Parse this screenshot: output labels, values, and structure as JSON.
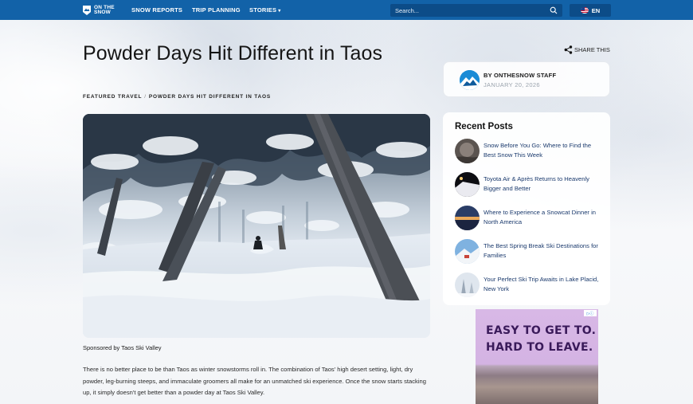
{
  "nav": {
    "logo_text_line1": "ON THE",
    "logo_text_line2": "SNOW",
    "links": [
      "SNOW REPORTS",
      "TRIP PLANNING",
      "STORIES"
    ],
    "search_placeholder": "Search...",
    "language": "EN",
    "brand_color": "#1262a8"
  },
  "article": {
    "title": "Powder Days Hit Different in Taos",
    "share_label": "SHARE THIS",
    "author": "BY ONTHESNOW STAFF",
    "date": "JANUARY 20, 2026",
    "breadcrumb": [
      "FEATURED TRAVEL",
      "POWDER DAYS HIT DIFFERENT IN TAOS"
    ],
    "breadcrumb_sep": "/",
    "caption": "Sponsored by Taos Ski Valley",
    "paragraph": "There is no better place to be than Taos as winter snowstorms roll in. The combination of Taos' high desert setting, light, dry powder, leg-burning steeps, and immaculate groomers all make for an unmatched ski experience. Once the snow starts stacking up, it simply doesn't get better than a powder day at Taos Ski Valley."
  },
  "sidebar": {
    "recent_title": "Recent Posts",
    "posts": [
      {
        "title": "Snow Before You Go: Where to Find the Best Snow This Week"
      },
      {
        "title": "Toyota Air & Après Returns to Heavenly Bigger and Better"
      },
      {
        "title": "Where to Experience a Snowcat Dinner in North America"
      },
      {
        "title": "The Best Spring Break Ski Destinations for Families"
      },
      {
        "title": "Your Perfect Ski Trip Awaits in Lake Placid, New York"
      }
    ],
    "ad": {
      "line1": "EASY TO GET TO.",
      "line2": "HARD TO LEAVE."
    }
  }
}
